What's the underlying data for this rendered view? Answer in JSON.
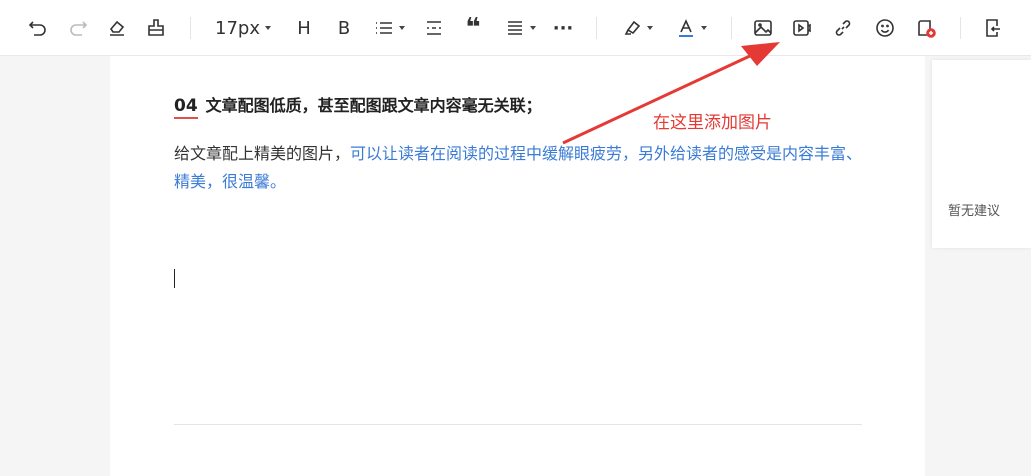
{
  "toolbar": {
    "font_size": "17px",
    "heading_label": "H",
    "bold_label": "B",
    "more_label": "···",
    "icons": [
      "undo-icon",
      "redo-icon",
      "eraser-icon",
      "format-painter-icon",
      "list-icon",
      "divider-icon",
      "quote-icon",
      "align-icon",
      "highlighter-icon",
      "font-color-icon",
      "image-icon",
      "video-icon",
      "link-icon",
      "emoji-icon",
      "add-card-icon",
      "export-icon"
    ],
    "font_color": "#3a7bd5"
  },
  "document": {
    "heading_number": "04",
    "heading_text": "文章配图低质，甚至配图跟文章内容毫无关联；",
    "para_black": "给文章配上精美的图片，",
    "para_blue": "可以让读者在阅读的过程中缓解眼疲劳，另外给读者的感受是内容丰富、精美，很温馨。"
  },
  "side_panel": {
    "empty_text": "暂无建议"
  },
  "annotation": {
    "text": "在这里添加图片",
    "color": "#e53935"
  }
}
